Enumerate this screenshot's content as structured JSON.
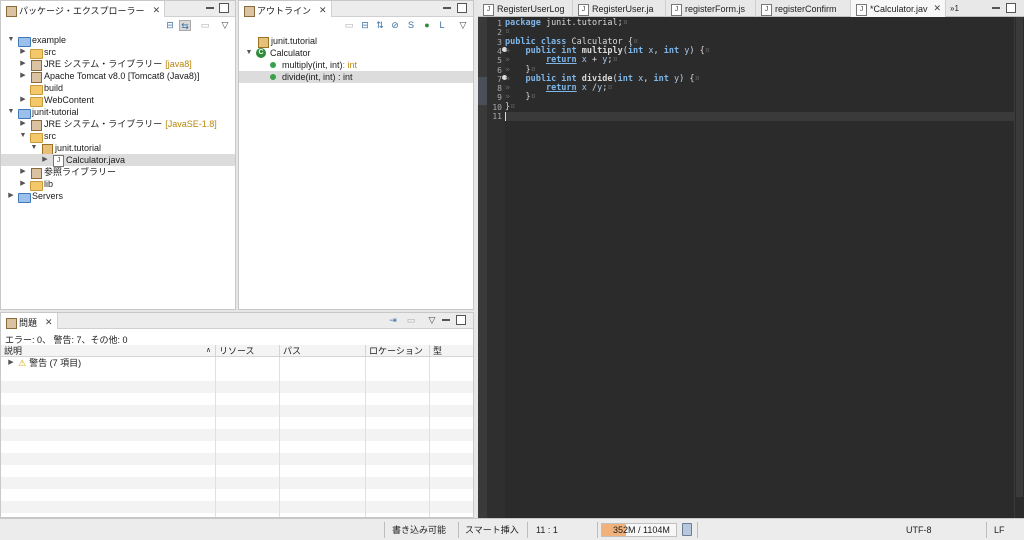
{
  "package_explorer": {
    "title": "パッケージ・エクスプローラー",
    "items": [
      {
        "label": "example",
        "suffix": ""
      },
      {
        "label": "src",
        "suffix": ""
      },
      {
        "label": "JRE システム・ライブラリー",
        "suffix": "[java8]"
      },
      {
        "label": "Apache Tomcat v8.0 [Tomcat8 (Java8)]",
        "suffix": ""
      },
      {
        "label": "build",
        "suffix": ""
      },
      {
        "label": "WebContent",
        "suffix": ""
      },
      {
        "label": "junit-tutorial",
        "suffix": ""
      },
      {
        "label": "JRE システム・ライブラリー",
        "suffix": "[JavaSE-1.8]"
      },
      {
        "label": "src",
        "suffix": ""
      },
      {
        "label": "junit.tutorial",
        "suffix": ""
      },
      {
        "label": "Calculator.java",
        "suffix": ""
      },
      {
        "label": "参照ライブラリー",
        "suffix": ""
      },
      {
        "label": "lib",
        "suffix": ""
      },
      {
        "label": "Servers",
        "suffix": ""
      }
    ]
  },
  "outline": {
    "title": "アウトライン",
    "items": [
      {
        "label": "junit.tutorial",
        "suffix": ""
      },
      {
        "label": "Calculator",
        "suffix": ""
      },
      {
        "label": "multiply(int, int)",
        "suffix": " : int"
      },
      {
        "label": "divide(int, int) : int",
        "suffix": ""
      }
    ]
  },
  "editor": {
    "tabs": [
      {
        "label": "RegisterUserLog"
      },
      {
        "label": "RegisterUser.ja"
      },
      {
        "label": "registerForm.js"
      },
      {
        "label": "registerConfirm"
      },
      {
        "label": "*Calculator.jav"
      }
    ],
    "overflow": "»1",
    "line_numbers": [
      "1",
      "2",
      "3",
      "4",
      "5",
      "6",
      "7",
      "8",
      "9",
      "10",
      "11"
    ]
  },
  "problems": {
    "title": "問題",
    "summary": "エラー: 0、 警告: 7、その他: 0",
    "columns": [
      "説明",
      "リソース",
      "パス",
      "ロケーション",
      "型"
    ],
    "rows": [
      {
        "label": "警告 (7 項目)"
      }
    ]
  },
  "statusbar": {
    "writable": "書き込み可能",
    "insert_mode": "スマート挿入",
    "position": "11 : 1",
    "memory": "352M / 1104M",
    "memory_used_fraction": 0.32,
    "encoding": "UTF-8",
    "line_ending": "LF"
  }
}
